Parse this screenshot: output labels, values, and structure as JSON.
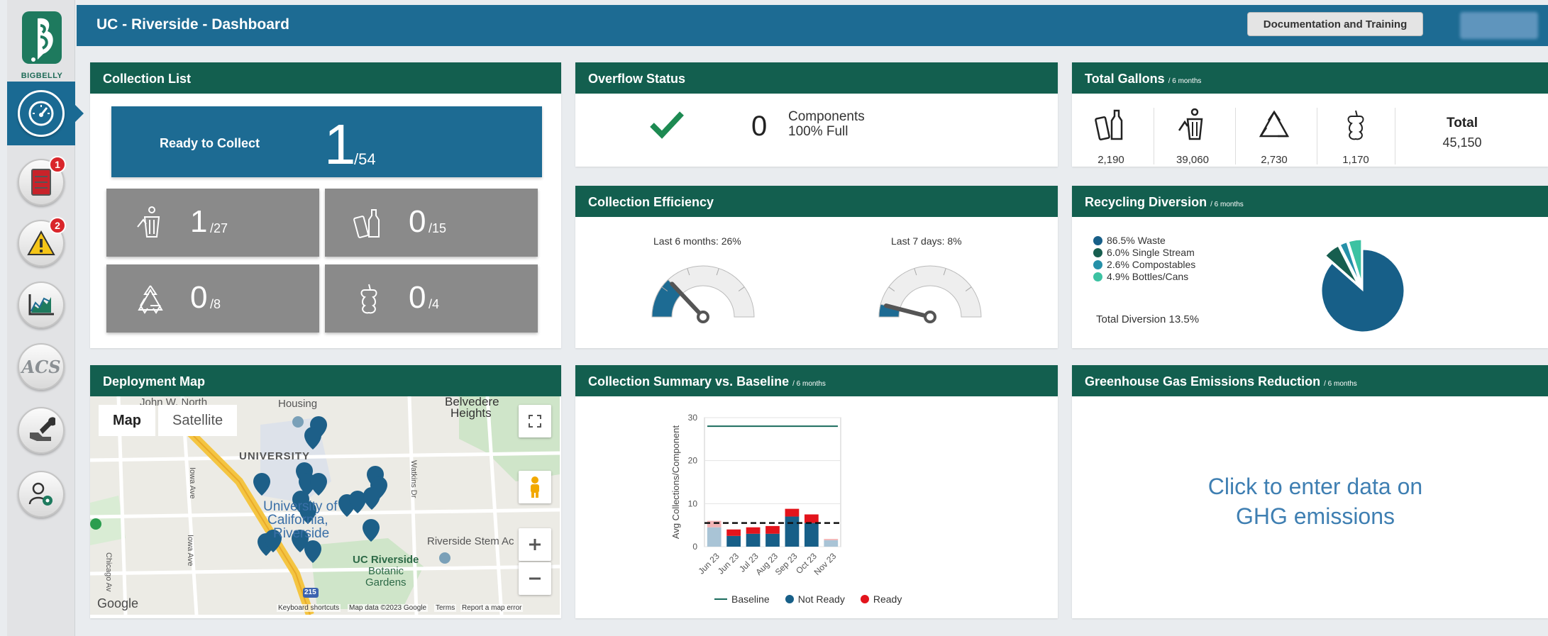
{
  "sidebar": {
    "logo_text": "BIGBELLY",
    "badges": {
      "collection": "1",
      "alerts": "2"
    },
    "acs_label": "ACS"
  },
  "header": {
    "title": "UC - Riverside - Dashboard",
    "doc_button": "Documentation and Training"
  },
  "collection_list": {
    "title": "Collection List",
    "ready_label": "Ready to Collect",
    "ready_count": "1",
    "ready_total": "/54",
    "tiles": [
      {
        "icon": "trash-icon",
        "count": "1",
        "total": "/27"
      },
      {
        "icon": "bottles-icon",
        "count": "0",
        "total": "/15"
      },
      {
        "icon": "recycle-icon",
        "count": "0",
        "total": "/8"
      },
      {
        "icon": "compost-icon",
        "count": "0",
        "total": "/4"
      }
    ]
  },
  "overflow": {
    "title": "Overflow Status",
    "count": "0",
    "label_line1": "Components",
    "label_line2": "100% Full"
  },
  "gallons": {
    "title": "Total Gallons",
    "subtitle": "/ 6 months",
    "items": [
      "2,190",
      "39,060",
      "2,730",
      "1,170"
    ],
    "total_label": "Total",
    "total_value": "45,150"
  },
  "efficiency": {
    "title": "Collection Efficiency",
    "gauge1_label": "Last 6 months: 26%",
    "gauge1_value": 26,
    "gauge2_label": "Last 7 days: 8%",
    "gauge2_value": 8
  },
  "recycling": {
    "title": "Recycling Diversion",
    "subtitle": "/ 6 months",
    "legend": [
      {
        "label": "86.5% Waste",
        "color": "#175f88"
      },
      {
        "label": "6.0% Single Stream",
        "color": "#175e4f"
      },
      {
        "label": "2.6% Compostables",
        "color": "#2590a8"
      },
      {
        "label": "4.9% Bottles/Cans",
        "color": "#3cc2a2"
      }
    ],
    "total_diversion": "Total Diversion 13.5%"
  },
  "map": {
    "title": "Deployment Map",
    "tab_map": "Map",
    "tab_satellite": "Satellite",
    "labels": {
      "john": "John W. North",
      "housing": "Housing",
      "belvedere": "Belvedere",
      "heights": "Heights",
      "university": "UNIVERSITY",
      "uc1": "University of",
      "uc2": "California,",
      "uc3": "Riverside",
      "stem": "Riverside Stem Ac",
      "garden1": "UC Riverside",
      "garden2": "Botanic",
      "garden3": "Gardens",
      "iowa1": "Iowa Ave",
      "iowa2": "Iowa Ave",
      "chicago": "Chicago Av",
      "watkins": "Watkins Dr",
      "hwy": "215",
      "google": "Google"
    },
    "footer": [
      "Keyboard shortcuts",
      "Map data ©2023 Google",
      "Terms",
      "Report a map error"
    ]
  },
  "summary": {
    "title": "Collection Summary vs. Baseline",
    "subtitle": "/ 6 months",
    "legend_baseline": "Baseline",
    "legend_not_ready": "Not Ready",
    "legend_ready": "Ready"
  },
  "chart_data": {
    "type": "bar",
    "ylabel": "Avg Collections/Component",
    "ylim": [
      0,
      30
    ],
    "yticks": [
      "0",
      "10",
      "20",
      "30"
    ],
    "categories": [
      "Jun 23",
      "Jun 23",
      "Jul 23",
      "Aug 23",
      "Sep 23",
      "Oct 23",
      "Nov 23"
    ],
    "series": [
      {
        "name": "Not Ready",
        "values": [
          4.5,
          2.5,
          3,
          3,
          7,
          5.5,
          1.5
        ],
        "color": "#175f88"
      },
      {
        "name": "Ready",
        "values": [
          1.5,
          1.5,
          1.5,
          1.8,
          1.8,
          2,
          0.3
        ],
        "color": "#e3141c"
      }
    ],
    "faded": [
      true,
      false,
      false,
      false,
      false,
      false,
      true
    ],
    "baseline": 28,
    "reference_dashed": 5.5
  },
  "ghg": {
    "title": "Greenhouse Gas Emissions Reduction",
    "subtitle": "/ 6 months",
    "line1": "Click to enter data on",
    "line2": "GHG emissions"
  }
}
